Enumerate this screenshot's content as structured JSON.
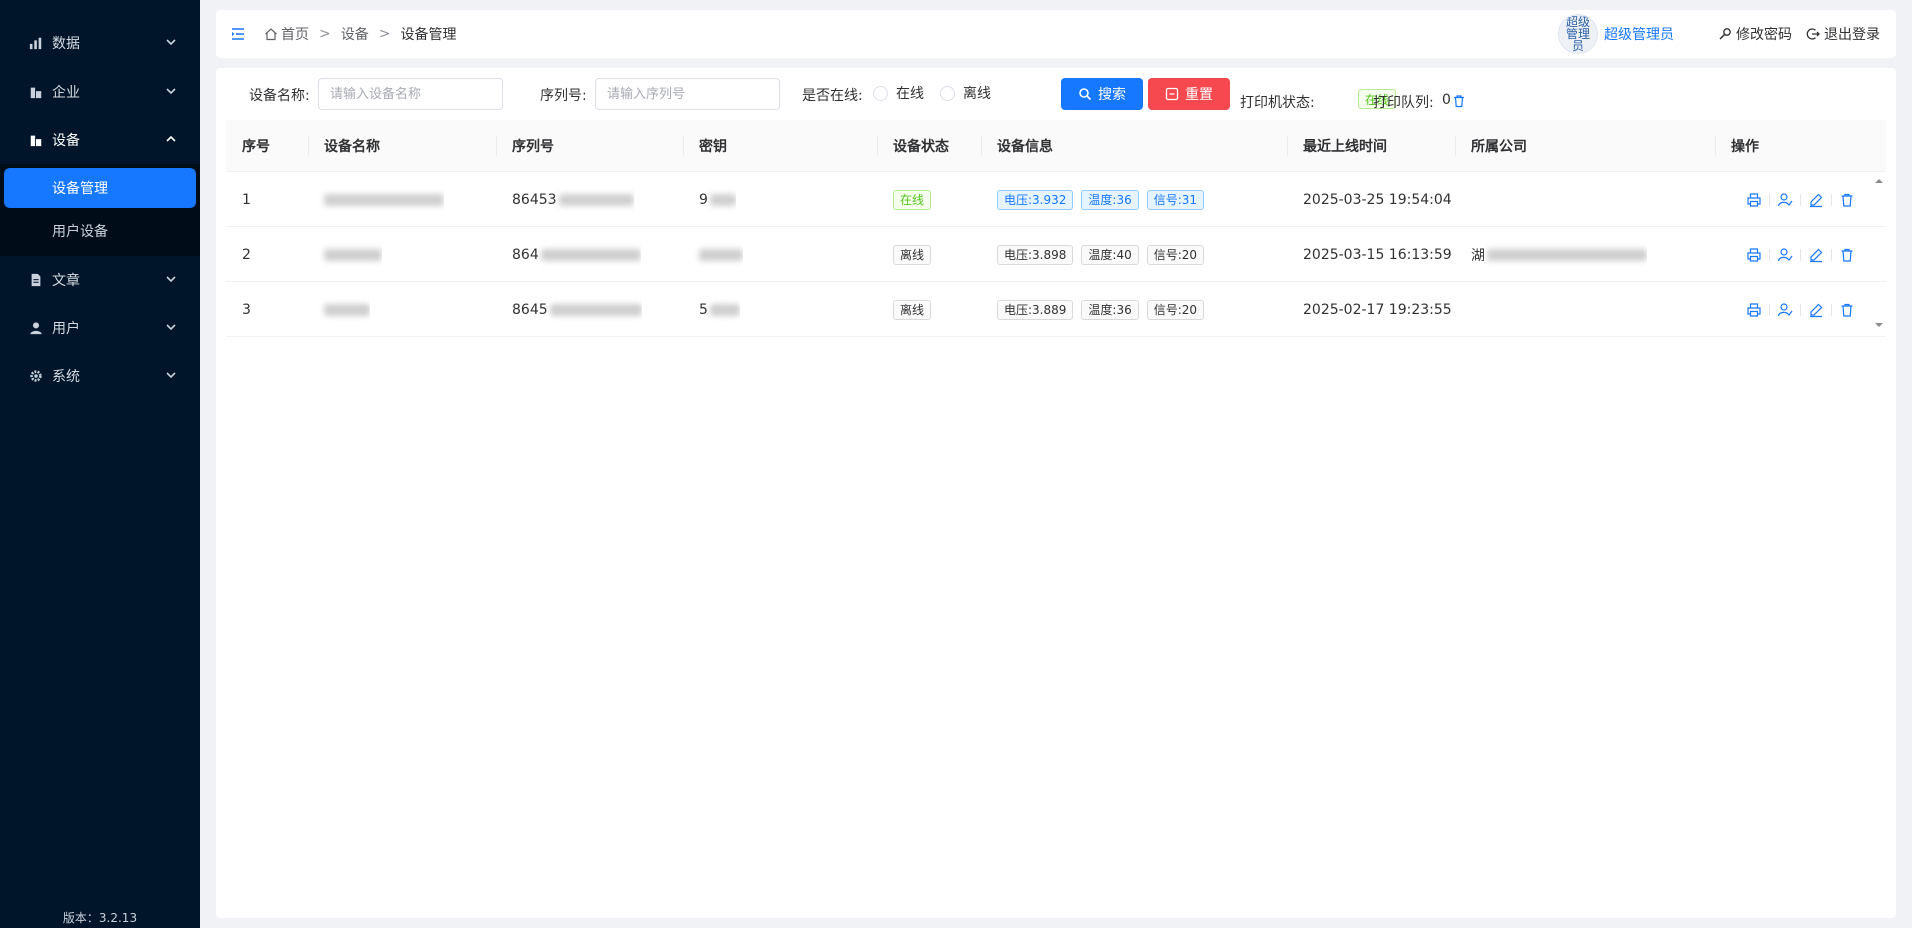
{
  "sidebar": {
    "menu": [
      {
        "label": "数据",
        "icon": "bar-chart-icon"
      },
      {
        "label": "企业",
        "icon": "building-icon"
      },
      {
        "label": "设备",
        "icon": "building-icon"
      },
      {
        "label": "文章",
        "icon": "document-icon"
      },
      {
        "label": "用户",
        "icon": "user-icon"
      },
      {
        "label": "系统",
        "icon": "gear-icon"
      }
    ],
    "submenu": [
      {
        "label": "设备管理",
        "active": true
      },
      {
        "label": "用户设备",
        "active": false
      }
    ],
    "version": "版本：3.2.13"
  },
  "header": {
    "breadcrumb": [
      "首页",
      "设备",
      "设备管理"
    ],
    "breadcrumb_sep": ">",
    "avatar_text": "超级管理员",
    "user_name": "超级管理员",
    "change_password": "修改密码",
    "logout": "退出登录"
  },
  "search": {
    "device_name_label": "设备名称:",
    "device_name_placeholder": "请输入设备名称",
    "serial_label": "序列号:",
    "serial_placeholder": "请输入序列号",
    "online_label": "是否在线:",
    "online_option": "在线",
    "offline_option": "离线",
    "search_button": "搜索",
    "reset_button": "重置",
    "printer_status_label": "打印机状态:",
    "printer_status_value": "在线",
    "print_queue_label": "打印队列:",
    "print_queue_value": "0"
  },
  "table": {
    "columns": [
      "序号",
      "设备名称",
      "序列号",
      "密钥",
      "设备状态",
      "设备信息",
      "最近上线时间",
      "所属公司",
      "操作"
    ],
    "rows": [
      {
        "index": "1",
        "name": "",
        "serial": "86453",
        "key": "9",
        "status": "在线",
        "online": true,
        "voltage": "电压:3.932",
        "temp": "温度:36",
        "signal": "信号:31",
        "last_online": "2025-03-25 19:54:04",
        "company": ""
      },
      {
        "index": "2",
        "name": "",
        "serial": "864",
        "key": "",
        "status": "离线",
        "online": false,
        "voltage": "电压:3.898",
        "temp": "温度:40",
        "signal": "信号:20",
        "last_online": "2025-03-15 16:13:59",
        "company": "湖"
      },
      {
        "index": "3",
        "name": "",
        "serial": "8645",
        "key": "5",
        "status": "离线",
        "online": false,
        "voltage": "电压:3.889",
        "temp": "温度:36",
        "signal": "信号:20",
        "last_online": "2025-02-17 19:23:55",
        "company": ""
      }
    ]
  },
  "colors": {
    "sidebar_bg": "#001529",
    "primary": "#1677ff",
    "danger": "#f5484f",
    "success": "#52c41a"
  }
}
